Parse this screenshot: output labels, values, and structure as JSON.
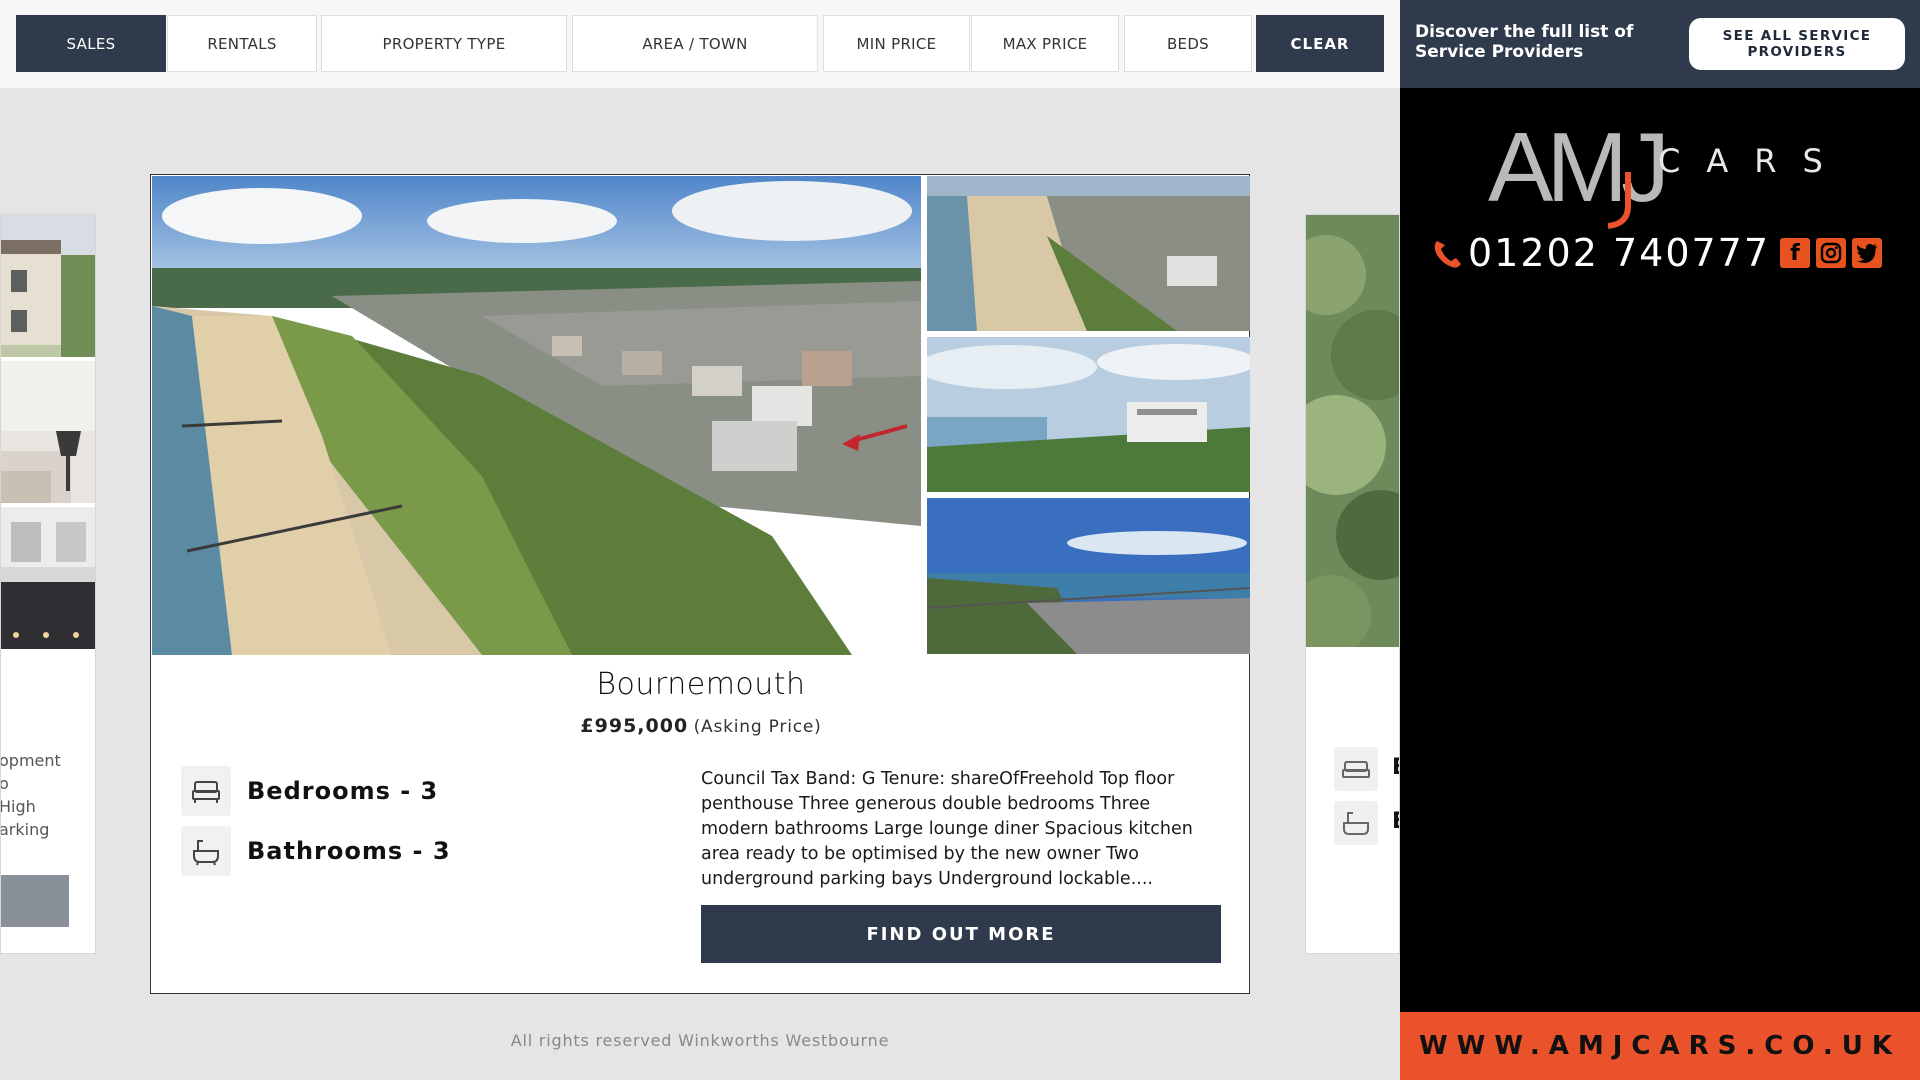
{
  "filters": {
    "sales": "SALES",
    "rentals": "RENTALS",
    "property_type": "PROPERTY TYPE",
    "area_town": "AREA / TOWN",
    "min_price": "MIN PRICE",
    "max_price": "MAX PRICE",
    "beds": "BEDS",
    "clear": "CLEAR"
  },
  "service_providers": {
    "text": "Discover the full list of Service Providers",
    "button": "SEE ALL SERVICE PROVIDERS"
  },
  "advert": {
    "logo_main": "AMJ",
    "logo_sub": "CARS",
    "phone": "01202 740777",
    "url": "WWW.AMJCARS.CO.UK",
    "accent_color": "#e9522a",
    "socials": [
      "facebook-icon",
      "instagram-icon",
      "twitter-icon"
    ]
  },
  "left_card": {
    "text_lines": [
      "opment",
      "o",
      "High",
      "arking"
    ]
  },
  "right_card": {
    "bed_letter": "B",
    "bath_letter": "B"
  },
  "property": {
    "title": "Bournemouth",
    "price": "£995,000",
    "price_qualifier": "(Asking Price)",
    "bedrooms": "Bedrooms - 3",
    "bathrooms": "Bathrooms - 3",
    "description": "Council Tax Band: G Tenure: shareOfFreehold Top floor penthouse Three generous double bedrooms Three modern bathrooms Large lounge diner Spacious kitchen area ready to be optimised by the new owner Two underground parking bays Underground lockable....",
    "button": "FIND OUT MORE"
  },
  "footer": {
    "text": "All rights reserved Winkworths Westbourne"
  },
  "colors": {
    "navy": "#2f3b4c",
    "orange": "#e9522a"
  }
}
